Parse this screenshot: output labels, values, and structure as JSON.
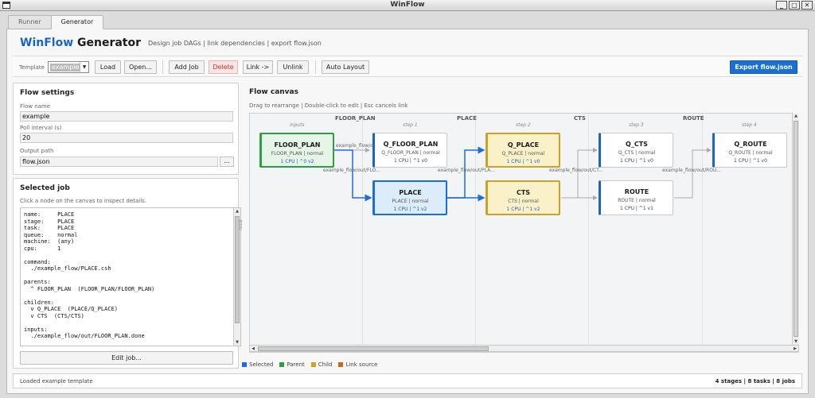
{
  "window": {
    "title": "WinFlow",
    "minimize": "_",
    "maximize": "□",
    "close": "✕"
  },
  "tabs": [
    {
      "label": "Runner"
    },
    {
      "label": "Generator"
    }
  ],
  "header": {
    "title_accent": "WinFlow",
    "title_rest": "Generator",
    "subtitle": "Design job DAGs | link dependencies | export flow.json"
  },
  "toolbar": {
    "template_label": "Template",
    "template_value": "example",
    "load": "Load",
    "open": "Open...",
    "add_job": "Add Job",
    "delete": "Delete",
    "link": "Link ->",
    "unlink": "Unlink",
    "auto_layout": "Auto Layout",
    "export": "Export flow.json"
  },
  "flow_settings": {
    "title": "Flow settings",
    "name_label": "Flow name",
    "name_value": "example",
    "poll_label": "Poll interval (s)",
    "poll_value": "20",
    "output_label": "Output path",
    "output_value": "flow.json",
    "browse": "..."
  },
  "selected_job": {
    "title": "Selected job",
    "hint": "Click a node on the canvas to inspect details.",
    "details": "name:     PLACE\nstage:    PLACE\ntask:     PLACE\nqueue:    normal\nmachine:  (any)\ncpu:      1\n\ncommand:\n  ./example_flow/PLACE.csh\n\nparents:\n  ^ FLOOR_PLAN  (FLOOR_PLAN/FLOOR_PLAN)\n\nchildren:\n  v Q_PLACE  (PLACE/Q_PLACE)\n  v CTS  (CTS/CTS)\n\ninputs:\n  ./example_flow/out/FLOOR_PLAN.done",
    "edit": "Edit job..."
  },
  "canvas": {
    "title": "Flow canvas",
    "hint": "Drag to rearrange | Double-click to edit | Esc cancels link",
    "lanes": [
      "FLOOR_PLAN",
      "PLACE",
      "CTS",
      "ROUTE"
    ],
    "columns": [
      "inputs",
      "step 1",
      "step 2",
      "step 3",
      "step 4"
    ],
    "edge_labels": [
      "example_flow/out/F...",
      "example_flow/out/FLO...",
      "example_flow/out/PLA...",
      "example_flow/out/CT...",
      "example_flow/out/ROU..."
    ],
    "nodes": [
      {
        "id": "FLOOR_PLAN",
        "name": "FLOOR_PLAN",
        "sub": "FLOOR_PLAN | normal",
        "meta": "1 CPU  |  ^0  v2",
        "role": "parent"
      },
      {
        "id": "Q_FLOOR_PLAN",
        "name": "Q_FLOOR_PLAN",
        "sub": "Q_FLOOR_PLAN | normal",
        "meta": "1 CPU  |  ^1  v0",
        "role": "normal"
      },
      {
        "id": "PLACE",
        "name": "PLACE",
        "sub": "PLACE | normal",
        "meta": "1 CPU  |  ^1  v2",
        "role": "selected"
      },
      {
        "id": "Q_PLACE",
        "name": "Q_PLACE",
        "sub": "Q_PLACE | normal",
        "meta": "1 CPU  |  ^1  v0",
        "role": "child"
      },
      {
        "id": "CTS",
        "name": "CTS",
        "sub": "CTS | normal",
        "meta": "1 CPU  |  ^1  v2",
        "role": "child"
      },
      {
        "id": "Q_CTS",
        "name": "Q_CTS",
        "sub": "Q_CTS | normal",
        "meta": "1 CPU  |  ^1  v0",
        "role": "normal"
      },
      {
        "id": "ROUTE",
        "name": "ROUTE",
        "sub": "ROUTE | normal",
        "meta": "1 CPU  |  ^1  v1",
        "role": "normal"
      },
      {
        "id": "Q_ROUTE",
        "name": "Q_ROUTE",
        "sub": "Q_ROUTE | normal",
        "meta": "1 CPU  |  ^1  v0",
        "role": "normal"
      }
    ]
  },
  "legend": [
    {
      "label": "Selected",
      "color": "#1a6fd6"
    },
    {
      "label": "Parent",
      "color": "#2e9e45"
    },
    {
      "label": "Child",
      "color": "#c9a227"
    },
    {
      "label": "Link source",
      "color": "#c8691c"
    }
  ],
  "status": {
    "message": "Loaded example template",
    "summary": "4 stages  |  8 tasks  |  8 jobs"
  }
}
